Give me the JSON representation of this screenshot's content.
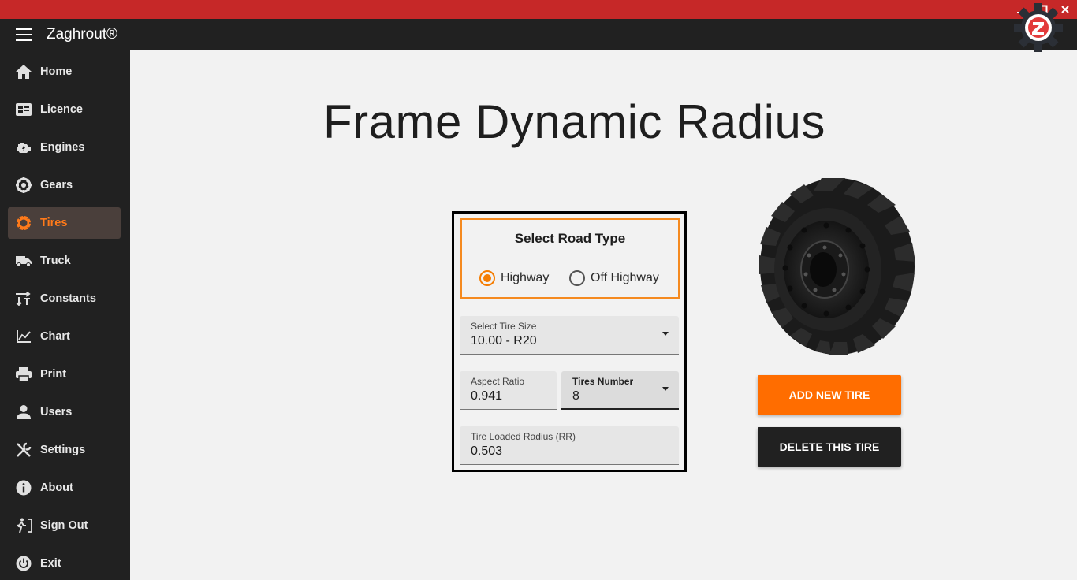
{
  "window": {
    "controls": [
      "minimize",
      "maximize",
      "close"
    ]
  },
  "app": {
    "title": "Zaghrout®"
  },
  "sidebar": {
    "items": [
      {
        "label": "Home",
        "icon": "home-icon"
      },
      {
        "label": "Licence",
        "icon": "licence-icon"
      },
      {
        "label": "Engines",
        "icon": "engine-icon"
      },
      {
        "label": "Gears",
        "icon": "gear-icon"
      },
      {
        "label": "Tires",
        "icon": "tire-icon",
        "active": true
      },
      {
        "label": "Truck",
        "icon": "truck-icon"
      },
      {
        "label": "Constants",
        "icon": "constants-icon"
      },
      {
        "label": "Chart",
        "icon": "chart-icon"
      },
      {
        "label": "Print",
        "icon": "print-icon"
      },
      {
        "label": "Users",
        "icon": "user-icon"
      },
      {
        "label": "Settings",
        "icon": "settings-icon"
      },
      {
        "label": "About",
        "icon": "info-icon"
      },
      {
        "label": "Sign Out",
        "icon": "sign-out-icon"
      },
      {
        "label": "Exit",
        "icon": "power-icon"
      }
    ]
  },
  "main": {
    "title": "Frame Dynamic Radius",
    "road_type": {
      "title": "Select Road Type",
      "options": [
        "Highway",
        "Off Highway"
      ],
      "selected": "Highway"
    },
    "tire_size": {
      "label": "Select Tire Size",
      "value": "10.00 - R20"
    },
    "aspect_ratio": {
      "label": "Aspect Ratio",
      "value": "0.941"
    },
    "tires_number": {
      "label": "Tires Number",
      "value": "8"
    },
    "loaded_radius": {
      "label": "Tire Loaded Radius (RR)",
      "value": "0.503"
    },
    "add_button": "ADD NEW TIRE",
    "delete_button": "DELETE THIS TIRE"
  },
  "colors": {
    "accent": "#ff6d00",
    "titlebar": "#c62828",
    "sidebar": "#212121",
    "active_item_bg": "#4a3f3b"
  }
}
